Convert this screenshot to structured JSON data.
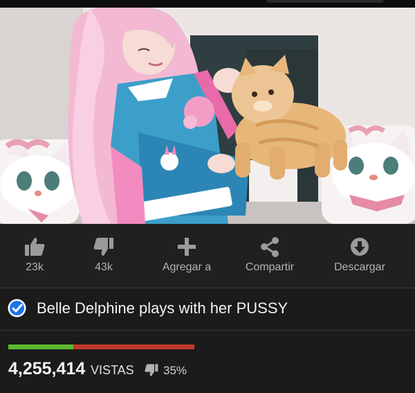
{
  "video": {
    "thumbnail_alt": "video-thumbnail"
  },
  "actions": {
    "likes": "23k",
    "dislikes": "43k",
    "add_to": "Agregar a",
    "share": "Compartir",
    "download": "Descargar"
  },
  "title": {
    "text": "Belle Delphine plays with her PUSSY",
    "verified_color": "#1a73e8"
  },
  "stats": {
    "like_ratio_percent": 35,
    "views": "4,255,414",
    "views_word": "VISTAS",
    "dislike_percent": "35%"
  },
  "colors": {
    "like_bar": "#5cb82f",
    "dislike_bar": "#c0392b",
    "background": "#1b1b1b"
  }
}
